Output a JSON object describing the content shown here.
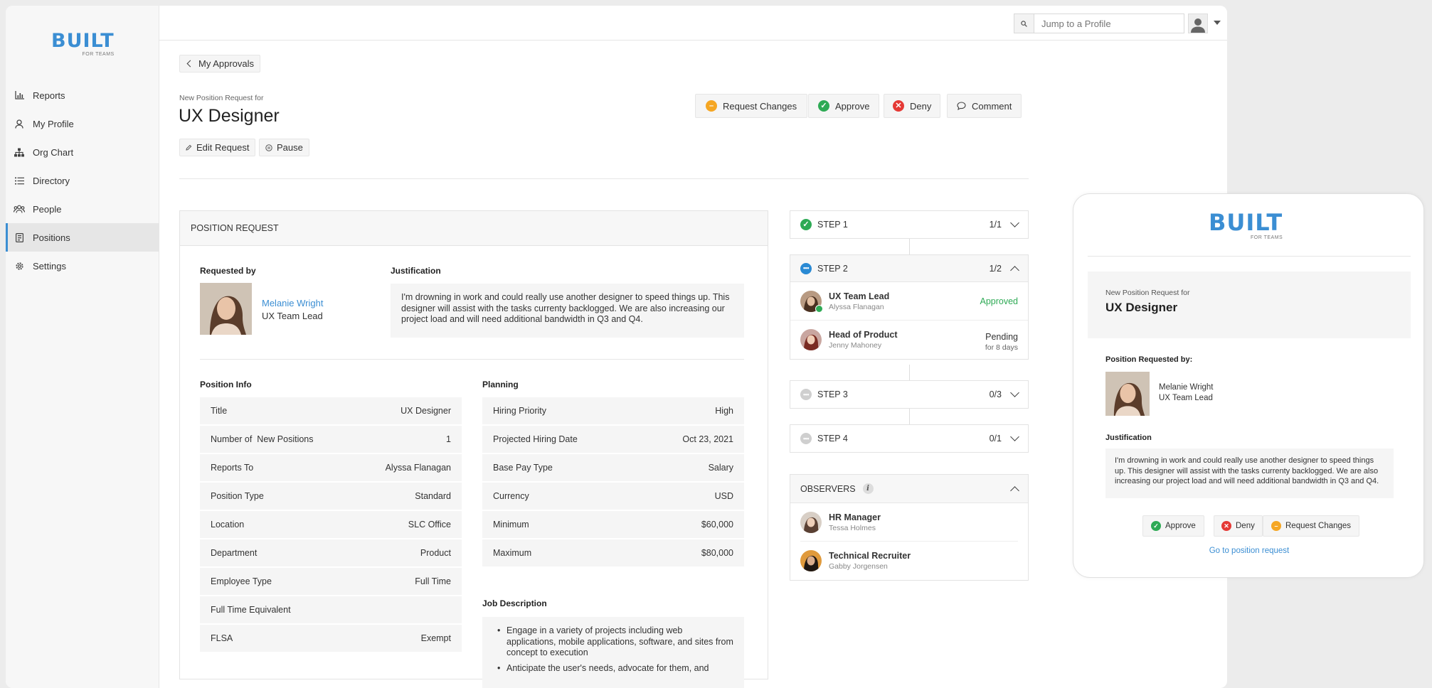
{
  "brand": {
    "word": "BUILT",
    "sub": "FOR TEAMS"
  },
  "sidebar": {
    "items": [
      {
        "label": "Reports",
        "icon": "bar-chart-icon"
      },
      {
        "label": "My Profile",
        "icon": "user-icon"
      },
      {
        "label": "Org Chart",
        "icon": "org-chart-icon"
      },
      {
        "label": "Directory",
        "icon": "list-icon"
      },
      {
        "label": "People",
        "icon": "people-icon"
      },
      {
        "label": "Positions",
        "icon": "badge-icon",
        "active": true
      },
      {
        "label": "Settings",
        "icon": "gear-icon"
      }
    ]
  },
  "topbar": {
    "search_placeholder": "Jump to a Profile"
  },
  "back": {
    "label": "My Approvals"
  },
  "header": {
    "subtitle": "New Position Request for",
    "title": "UX Designer"
  },
  "actions": {
    "request_changes": "Request Changes",
    "approve": "Approve",
    "deny": "Deny",
    "comment": "Comment"
  },
  "secondary": {
    "edit": "Edit Request",
    "pause": "Pause"
  },
  "colors": {
    "accent": "#3b8ed3",
    "approve": "#2eaa55",
    "deny": "#e53935",
    "changes": "#f5a623",
    "info": "#2a8ad4"
  },
  "request": {
    "section_title": "POSITION REQUEST",
    "requested_by_label": "Requested by",
    "requester_name": "Melanie Wright",
    "requester_role": "UX Team Lead",
    "justification_label": "Justification",
    "justification": "I'm drowning in work and could really use another designer to speed things up. This designer will assist with the tasks currenty backlogged. We are also increasing our project load and will need additional bandwidth in Q3 and Q4.",
    "position_info_label": "Position Info",
    "position_info": [
      {
        "label": "Title",
        "value": "UX Designer"
      },
      {
        "label": "Number of  New Positions",
        "value": "1"
      },
      {
        "label": "Reports To",
        "value": "Alyssa Flanagan"
      },
      {
        "label": "Position Type",
        "value": "Standard"
      },
      {
        "label": "Location",
        "value": "SLC Office"
      },
      {
        "label": "Department",
        "value": "Product"
      },
      {
        "label": "Employee Type",
        "value": "Full Time"
      },
      {
        "label": "Full Time Equivalent",
        "value": ""
      },
      {
        "label": "FLSA",
        "value": "Exempt"
      }
    ],
    "planning_label": "Planning",
    "planning": [
      {
        "label": "Hiring Priority",
        "value": "High"
      },
      {
        "label": "Projected Hiring Date",
        "value": "Oct 23, 2021"
      },
      {
        "label": "Base Pay Type",
        "value": "Salary"
      },
      {
        "label": "Currency",
        "value": "USD"
      },
      {
        "label": "Minimum",
        "value": "$60,000"
      },
      {
        "label": "Maximum",
        "value": "$80,000"
      }
    ],
    "job_description_label": "Job Description",
    "job_description": [
      "Engage in a variety of projects including web applications, mobile applications, software, and sites from concept to execution",
      "Anticipate the user's needs, advocate for them, and"
    ]
  },
  "steps": [
    {
      "label": "STEP 1",
      "count": "1/1",
      "state": "done"
    },
    {
      "label": "STEP 2",
      "count": "1/2",
      "state": "active",
      "approvers": [
        {
          "role": "UX Team Lead",
          "name": "Alyssa Flanagan",
          "status": "Approved",
          "status_sub": ""
        },
        {
          "role": "Head of Product",
          "name": "Jenny Mahoney",
          "status": "Pending",
          "status_sub": "for 8 days"
        }
      ]
    },
    {
      "label": "STEP 3",
      "count": "0/3",
      "state": "pending"
    },
    {
      "label": "STEP 4",
      "count": "0/1",
      "state": "pending"
    }
  ],
  "observers": {
    "label": "OBSERVERS",
    "people": [
      {
        "role": "HR Manager",
        "name": "Tessa Holmes"
      },
      {
        "role": "Technical Recruiter",
        "name": "Gabby Jorgensen"
      }
    ]
  },
  "mobile": {
    "subtitle": "New Position Request for",
    "title": "UX Designer",
    "requested_label": "Position Requested by:",
    "requester_name": "Melanie Wright",
    "requester_role": "UX Team Lead",
    "justification_label": "Justification",
    "justification": "I'm drowning in work and could really use another designer to speed things up. This designer will assist with the tasks currenty backlogged. We are also increasing our project load and will need additional bandwidth in Q3 and Q4.",
    "approve": "Approve",
    "deny": "Deny",
    "request_changes": "Request Changes",
    "link": "Go to position request"
  }
}
